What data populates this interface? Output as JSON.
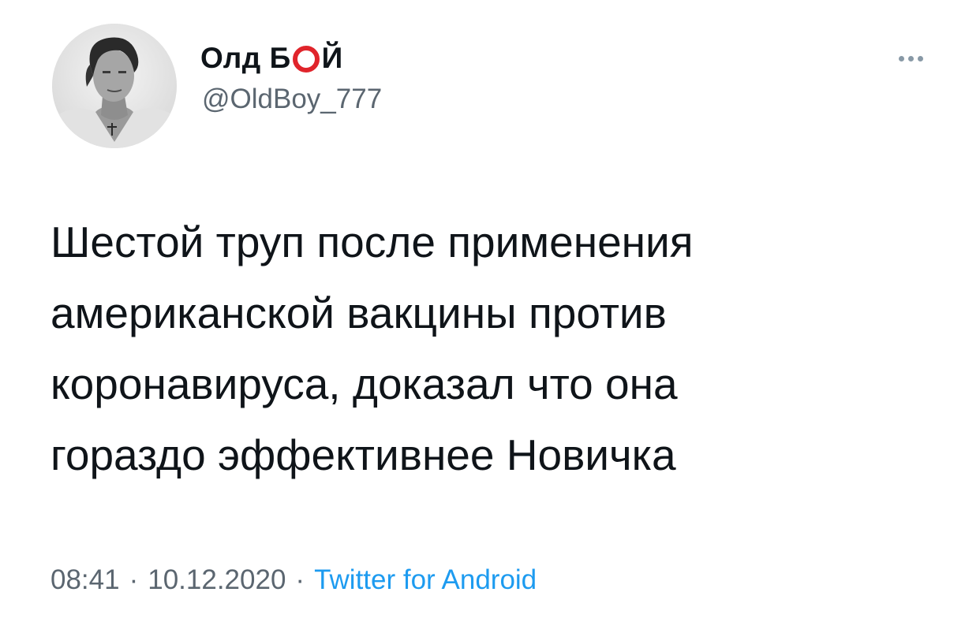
{
  "author": {
    "name_part1": "Олд Б",
    "name_part2": "Й",
    "handle": "@OldBoy_777"
  },
  "tweet": {
    "text": "Шестой труп после применения\nамериканской вакцины против\nкоронавируса, доказал что она\nгораздо эффективнее Новичка"
  },
  "meta": {
    "time": "08:41",
    "separator": "·",
    "date": "10.12.2020",
    "source": "Twitter for Android"
  },
  "icons": {
    "more": "more-horizontal-icon",
    "name_ring": "red-ring-icon"
  },
  "colors": {
    "text": "#0f1419",
    "secondary": "#5b6670",
    "link": "#1d9bf0",
    "ring": "#e0242b"
  }
}
